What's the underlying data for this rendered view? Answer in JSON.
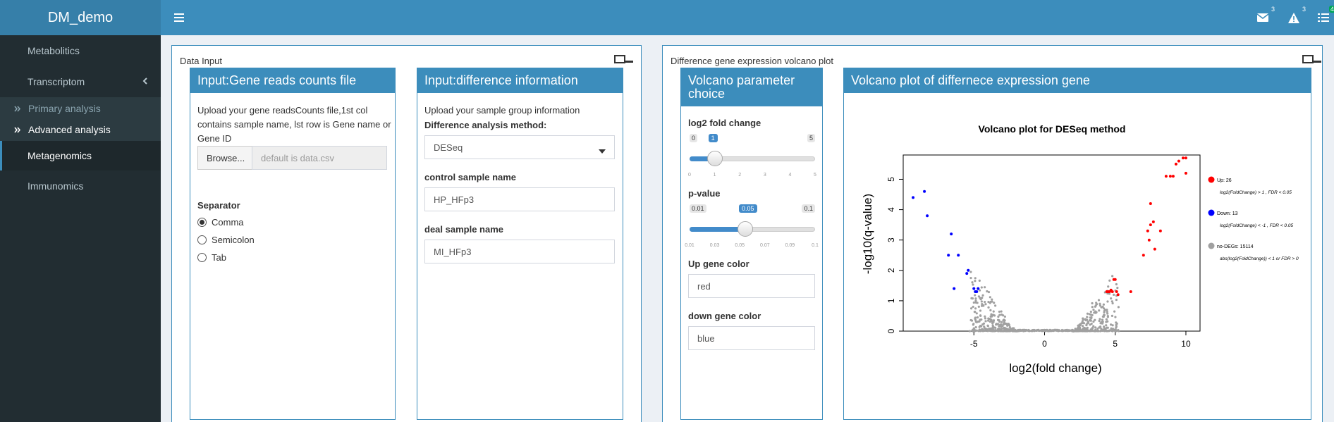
{
  "header": {
    "logo": "DM_demo",
    "messages_count": "3",
    "alerts_count": "3",
    "tasks_count": "4"
  },
  "sidebar": {
    "items": [
      {
        "label": "Metabolitics"
      },
      {
        "label": "Transcriptom"
      },
      {
        "label": "Metagenomics"
      },
      {
        "label": "Immunomics"
      }
    ],
    "subitems": [
      {
        "label": "Primary analysis"
      },
      {
        "label": "Advanced analysis"
      }
    ]
  },
  "data_input": {
    "title": "Data Input",
    "counts_box": {
      "title": "Input:Gene reads counts file",
      "help": "Upload your gene readsCounts file,1st col contains sample name, lst row is Gene name or Gene ID",
      "browse": "Browse...",
      "file_placeholder": "default is data.csv",
      "separator_label": "Separator",
      "separators": [
        "Comma",
        "Semicolon",
        "Tab"
      ],
      "selected_separator": "Comma"
    },
    "diff_box": {
      "title": "Input:difference information",
      "help": "Upload your sample group information",
      "method_label": "Difference analysis method:",
      "method_value": "DESeq",
      "control_label": "control sample name",
      "control_value": "HP_HFp3",
      "deal_label": "deal sample name",
      "deal_value": "MI_HFp3"
    }
  },
  "volcano_section": {
    "title": "Difference gene expression volcano plot",
    "params": {
      "title": "Volcano parameter choice",
      "fc_label": "log2 fold change",
      "fc_min": "0",
      "fc_max": "5",
      "fc_value": "1",
      "fc_fraction": 0.2,
      "fc_ticks": [
        "0",
        "1",
        "2",
        "3",
        "4",
        "5"
      ],
      "p_label": "p-value",
      "p_min": "0.01",
      "p_max": "0.1",
      "p_value": "0.05",
      "p_fraction": 0.444,
      "p_ticks": [
        "0.01",
        "0.03",
        "0.05",
        "0.07",
        "0.09",
        "0.1"
      ],
      "up_color_label": "Up gene color",
      "up_color_value": "red",
      "down_color_label": "down gene color",
      "down_color_value": "blue"
    },
    "plot_box": {
      "title": "Volcano plot of differnece expression gene"
    }
  },
  "chart_data": {
    "type": "scatter",
    "title": "Volcano plot for DESeq method",
    "xlabel": "log2(fold change)",
    "ylabel": "-log10(q-value)",
    "xlim": [
      -10,
      11
    ],
    "ylim": [
      0,
      5.8
    ],
    "x_ticks": [
      "-5",
      "0",
      "5",
      "10"
    ],
    "y_ticks": [
      "0",
      "1",
      "2",
      "3",
      "4",
      "5"
    ],
    "colors": {
      "up": "#ff0000",
      "down": "#0000ff",
      "none": "#a0a0a0"
    },
    "legend": [
      {
        "label": "Up: 26",
        "sub": "log2(FoldChange) > 1 , FDR < 0.05",
        "key": "up"
      },
      {
        "label": "Down: 13",
        "sub": "log2(FoldChange) < -1 , FDR < 0.05",
        "key": "down"
      },
      {
        "label": "no-DEGs: 15114",
        "sub": "abs(log2(FoldChange)) < 1  or FDR > 0",
        "key": "none"
      }
    ],
    "series": [
      {
        "name": "Up",
        "points": [
          [
            9.8,
            5.7
          ],
          [
            10,
            5.7
          ],
          [
            9.5,
            5.6
          ],
          [
            9.3,
            5.5
          ],
          [
            10,
            5.2
          ],
          [
            9.1,
            5.1
          ],
          [
            8.9,
            5.1
          ],
          [
            8.6,
            5.1
          ],
          [
            7.5,
            4.2
          ],
          [
            7.7,
            3.6
          ],
          [
            7.5,
            3.5
          ],
          [
            7.3,
            3.3
          ],
          [
            8.2,
            3.3
          ],
          [
            7.4,
            3.0
          ],
          [
            7.8,
            2.7
          ],
          [
            7,
            2.5
          ],
          [
            5,
            1.7
          ],
          [
            4.9,
            1.7
          ],
          [
            4.8,
            1.3
          ],
          [
            4.6,
            1.3
          ],
          [
            5.1,
            1.3
          ],
          [
            6.1,
            1.3
          ],
          [
            4.4,
            1.3
          ],
          [
            4.5,
            1.3
          ],
          [
            5.2,
            1.2
          ],
          [
            4.7,
            1.35
          ]
        ]
      },
      {
        "name": "Down",
        "points": [
          [
            -8.5,
            4.6
          ],
          [
            -9.3,
            4.4
          ],
          [
            -8.3,
            3.8
          ],
          [
            -6.6,
            3.2
          ],
          [
            -6.1,
            2.5
          ],
          [
            -6.8,
            2.5
          ],
          [
            -5.4,
            2.0
          ],
          [
            -6.4,
            1.4
          ],
          [
            -5.0,
            1.4
          ],
          [
            -4.8,
            1.3
          ],
          [
            -4.9,
            1.3
          ],
          [
            -5.5,
            1.9
          ],
          [
            -4.7,
            1.4
          ]
        ]
      }
    ]
  }
}
